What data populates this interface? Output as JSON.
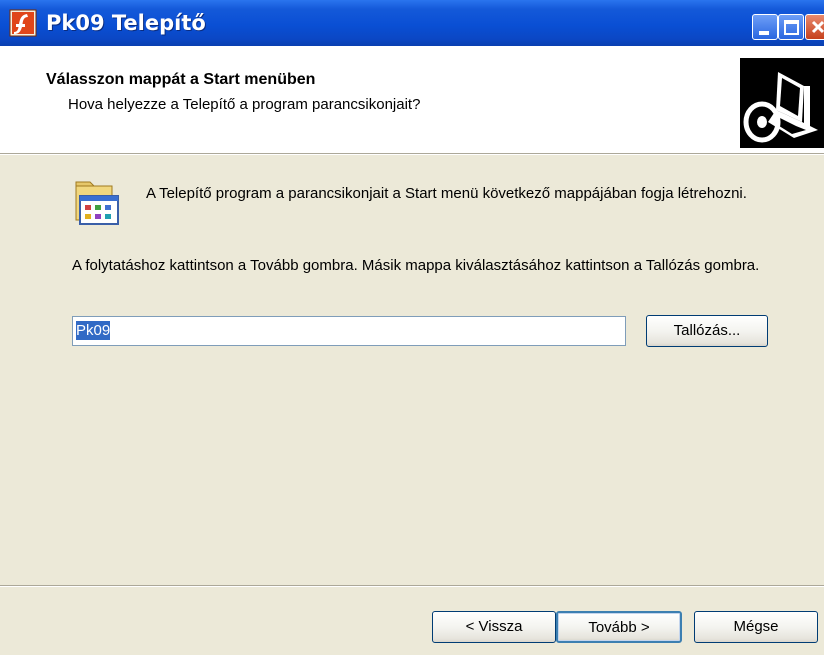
{
  "window": {
    "title": "Pk09 Telepítő"
  },
  "header": {
    "title": "Válasszon mappát a Start menüben",
    "subtitle": "Hova helyezze a Telepítő a program parancsikonjait?"
  },
  "body": {
    "intro_text": "A Telepítő program a parancsikonjait a Start menü következő mappájában fogja létrehozni.",
    "instruction_text": "A folytatáshoz kattintson a Tovább gombra. Másik mappa kiválasztásához kattintson a Tallózás gombra.",
    "folder_input_value": "Pk09",
    "browse_label": "Tallózás..."
  },
  "footer": {
    "back_label": "< Vissza",
    "next_label": "Tovább >",
    "cancel_label": "Mégse"
  },
  "icons": {
    "app": "installer-flash-icon",
    "header": "computer-cd-icon",
    "folder": "program-group-folder-icon"
  },
  "colors": {
    "titlebar": "#0a4fd4",
    "dialog_bg": "#ece9d8",
    "selection": "#316ac5"
  }
}
